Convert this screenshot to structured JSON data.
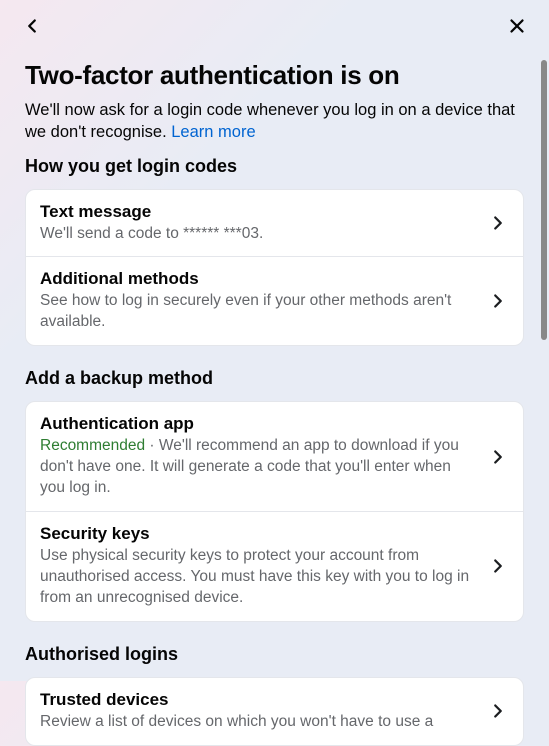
{
  "header": {
    "title": "Two-factor authentication is on",
    "description": "We'll now ask for a login code whenever you log in on a device that we don't recognise. ",
    "learn_more": "Learn more"
  },
  "sections": {
    "login_codes": {
      "heading": "How you get login codes",
      "text_message": {
        "title": "Text message",
        "sub": "We'll send a code to ****** ***03."
      },
      "additional": {
        "title": "Additional methods",
        "sub": "See how to log in securely even if your other methods aren't available."
      }
    },
    "backup": {
      "heading": "Add a backup method",
      "auth_app": {
        "title": "Authentication app",
        "recommended": "Recommended",
        "sub": " · We'll recommend an app to download if you don't have one. It will generate a code that you'll enter when you log in."
      },
      "security_keys": {
        "title": "Security keys",
        "sub": "Use physical security keys to protect your account from unauthorised access. You must have this key with you to log in from an unrecognised device."
      }
    },
    "authorised": {
      "heading": "Authorised logins",
      "trusted": {
        "title": "Trusted devices",
        "sub": "Review a list of devices on which you won't have to use a"
      }
    }
  }
}
